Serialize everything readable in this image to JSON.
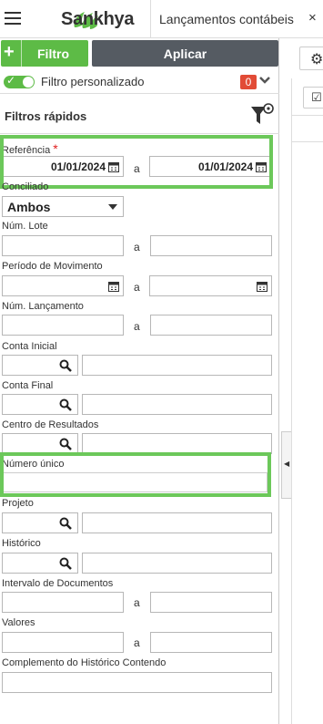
{
  "app": {
    "brand": "Sankhya",
    "tab_title": "Lançamentos contábeis",
    "close_glyph": "×"
  },
  "toolbar": {
    "add_glyph": "+",
    "filter_label": "Filtro",
    "apply_label": "Aplicar"
  },
  "custom_filter": {
    "label": "Filtro personalizado",
    "count": "0",
    "enabled": true
  },
  "quick_filters": {
    "title": "Filtros rápidos"
  },
  "fields": {
    "referencia": {
      "label": "Referência",
      "required_mark": "*",
      "from": "01/01/2024",
      "to": "01/01/2024",
      "sep": "a"
    },
    "conciliado": {
      "label": "Conciliado",
      "value": "Ambos"
    },
    "num_lote": {
      "label": "Núm. Lote",
      "sep": "a"
    },
    "periodo_movimento": {
      "label": "Período de Movimento",
      "sep": "a"
    },
    "num_lancamento": {
      "label": "Núm. Lançamento",
      "sep": "a"
    },
    "conta_inicial": {
      "label": "Conta Inicial"
    },
    "conta_final": {
      "label": "Conta Final"
    },
    "centro_resultados": {
      "label": "Centro de Resultados"
    },
    "numero_unico": {
      "label": "Número único"
    },
    "projeto": {
      "label": "Projeto"
    },
    "historico": {
      "label": "Histórico"
    },
    "intervalo_documentos": {
      "label": "Intervalo de Documentos",
      "sep": "a"
    },
    "valores": {
      "label": "Valores",
      "sep": "a"
    },
    "complemento_historico": {
      "label": "Complemento do Histórico Contendo"
    }
  },
  "colors": {
    "accent_green": "#5dbb46",
    "highlight_green": "#6cc85a",
    "apply_dark": "#555b62",
    "badge_red": "#e24b36"
  }
}
